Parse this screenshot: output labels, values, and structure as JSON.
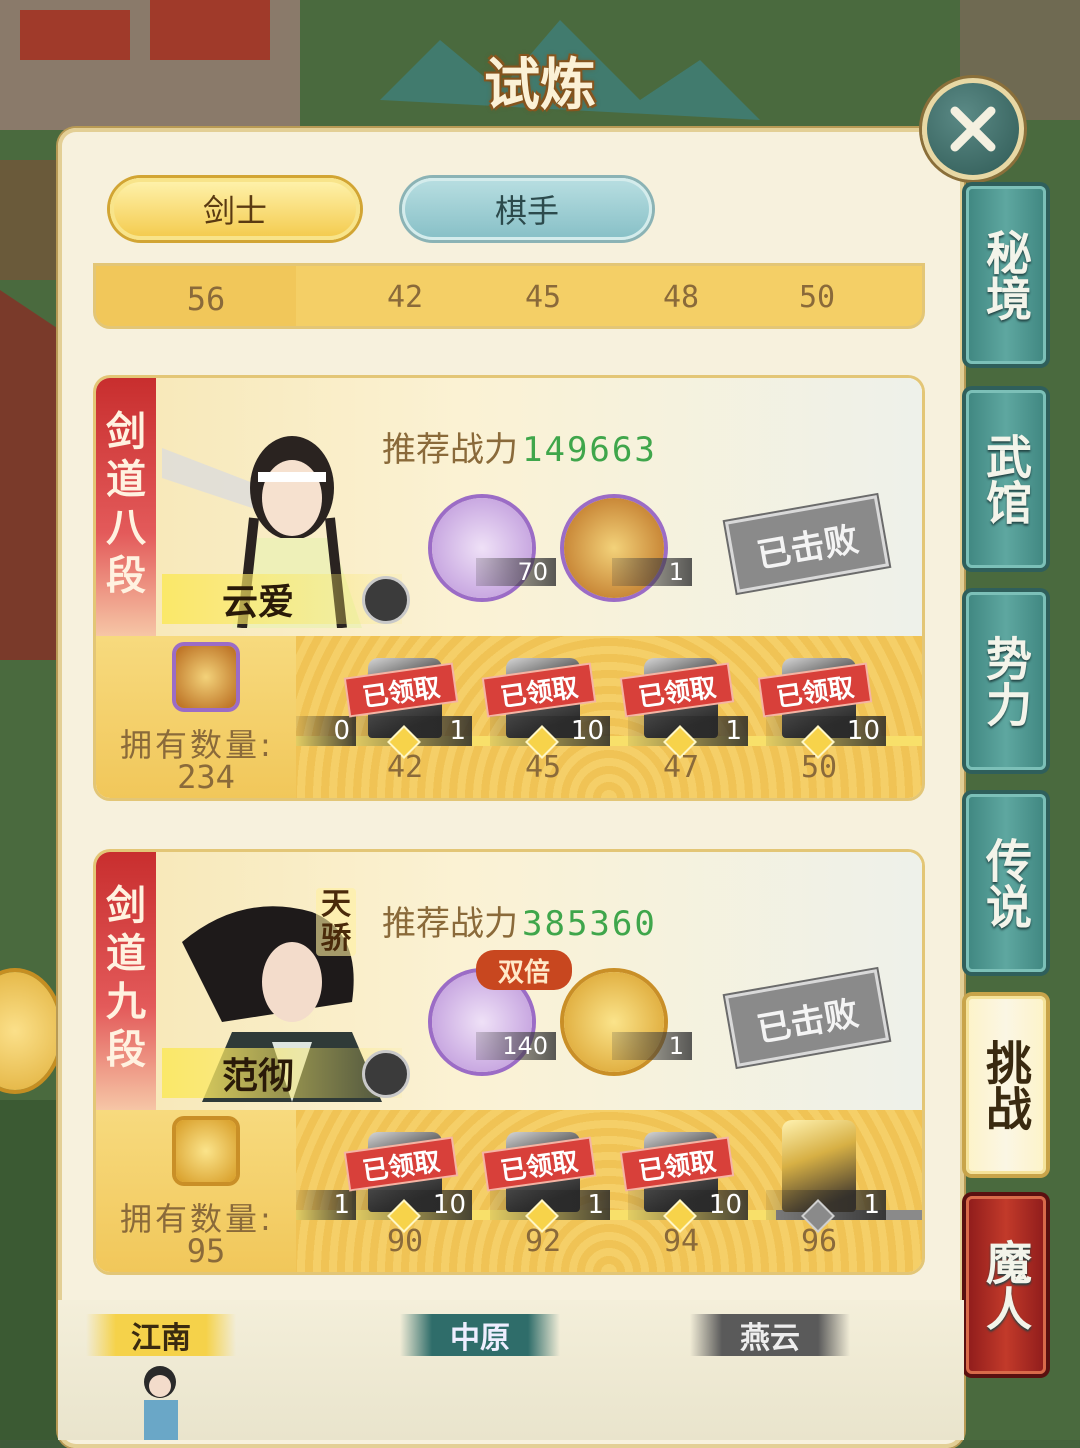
{
  "header": {
    "title": "试炼"
  },
  "tabs": {
    "jianshi": "剑士",
    "qishou": "棋手"
  },
  "side_tabs": [
    {
      "label": "秘境",
      "state": "normal"
    },
    {
      "label": "武馆",
      "state": "normal"
    },
    {
      "label": "势力",
      "state": "normal"
    },
    {
      "label": "传说",
      "state": "normal"
    },
    {
      "label": "挑战",
      "state": "active"
    },
    {
      "label": "魔人",
      "state": "special"
    }
  ],
  "partial_card": {
    "own_label": "拥有数量:",
    "own_count": "56",
    "milestones": [
      "42",
      "45",
      "48",
      "50"
    ]
  },
  "cards": [
    {
      "rank": [
        "剑",
        "道",
        "八",
        "段"
      ],
      "name": "云爱",
      "rec_label": "推荐战力",
      "rec_value": "149663",
      "reward_qty": [
        "70",
        "1"
      ],
      "status": "已击败",
      "own_label": "拥有数量:",
      "own_count": "234",
      "milestones": [
        {
          "claimed": "已领取",
          "qty": "1",
          "label": "42"
        },
        {
          "claimed": "已领取",
          "qty": "10",
          "label": "45"
        },
        {
          "claimed": "已领取",
          "qty": "1",
          "label": "47"
        },
        {
          "claimed": "已领取",
          "qty": "10",
          "label": "50"
        }
      ],
      "first_qty": "0"
    },
    {
      "rank": [
        "剑",
        "道",
        "九",
        "段"
      ],
      "name": "范彻",
      "title_tag": [
        "天",
        "骄"
      ],
      "rec_label": "推荐战力",
      "rec_value": "385360",
      "double_label": "双倍",
      "reward_qty": [
        "140",
        "1"
      ],
      "status": "已击败",
      "own_label": "拥有数量:",
      "own_count": "95",
      "milestones": [
        {
          "claimed": "已领取",
          "qty": "10",
          "label": "90"
        },
        {
          "claimed": "已领取",
          "qty": "1",
          "label": "92"
        },
        {
          "claimed": "已领取",
          "qty": "10",
          "label": "94"
        },
        {
          "claimed": "",
          "qty": "1",
          "label": "96"
        }
      ],
      "first_qty": "1"
    }
  ],
  "regions": {
    "jiangnan": "江南",
    "zhongyuan": "中原",
    "yanyun": "燕云"
  },
  "icons": {
    "close": "close-icon",
    "swap": "swap-icon",
    "chat": "chat-icon"
  },
  "colors": {
    "accent_gold": "#f3c94a",
    "teal": "#3f8680",
    "claimed_red": "#d8403a",
    "power_green": "#3fa64b"
  }
}
